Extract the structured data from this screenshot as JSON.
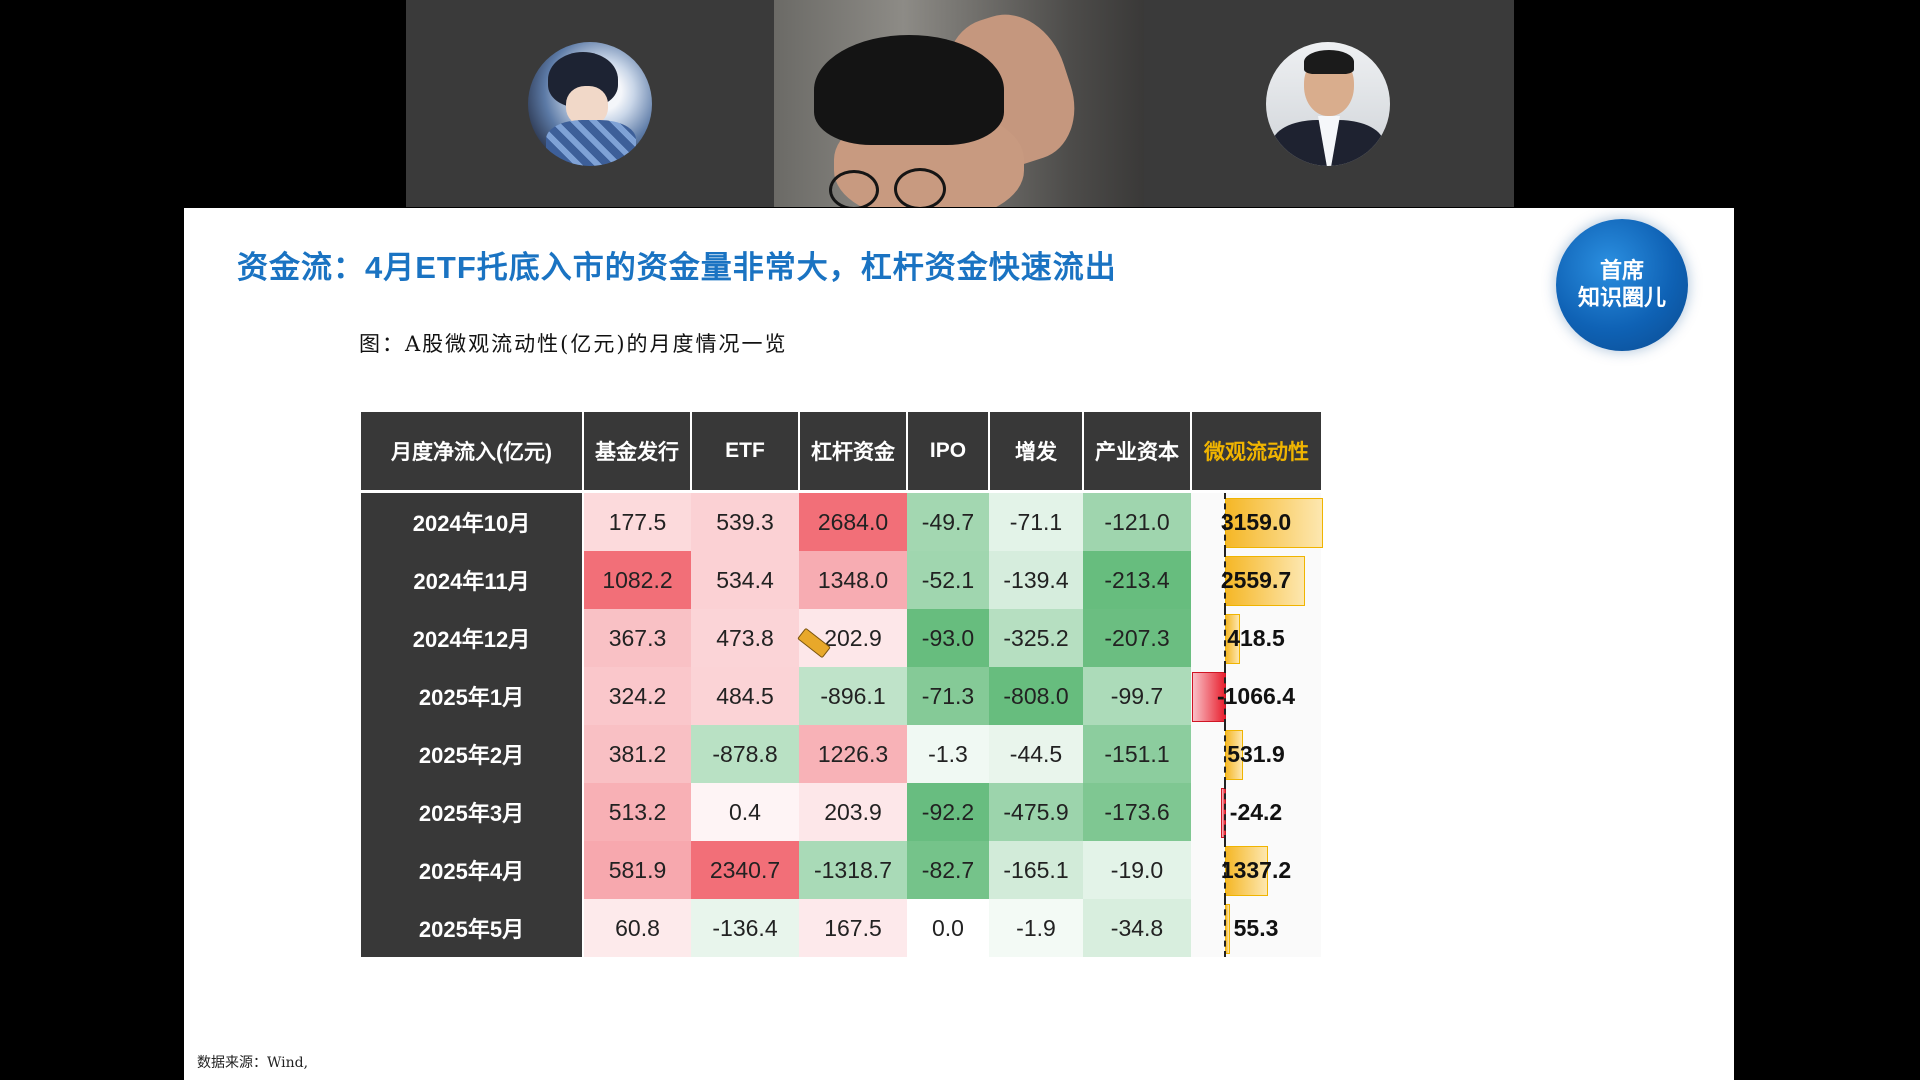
{
  "slide": {
    "title": "资金流：4月ETF托底入市的资金量非常大，杠杆资金快速流出",
    "logo_line1": "首席",
    "logo_line2": "知识圈儿",
    "caption": "图：A股微观流动性(亿元)的月度情况一览",
    "source": "数据来源：Wind,"
  },
  "table": {
    "headers": [
      "月度净流入(亿元)",
      "基金发行",
      "ETF",
      "杠杆资金",
      "IPO",
      "增发",
      "产业资本",
      "微观流动性"
    ],
    "rows": [
      {
        "month": "2024年10月",
        "cells": [
          "177.5",
          "539.3",
          "2684.0",
          "-49.7",
          "-71.1",
          "-121.0"
        ],
        "micro": "3159.0",
        "micro_value": 3159.0
      },
      {
        "month": "2024年11月",
        "cells": [
          "1082.2",
          "534.4",
          "1348.0",
          "-52.1",
          "-139.4",
          "-213.4"
        ],
        "micro": "2559.7",
        "micro_value": 2559.7
      },
      {
        "month": "2024年12月",
        "cells": [
          "367.3",
          "473.8",
          "202.9",
          "-93.0",
          "-325.2",
          "-207.3"
        ],
        "micro": "418.5",
        "micro_value": 418.5
      },
      {
        "month": "2025年1月",
        "cells": [
          "324.2",
          "484.5",
          "-896.1",
          "-71.3",
          "-808.0",
          "-99.7"
        ],
        "micro": "-1066.4",
        "micro_value": -1066.4
      },
      {
        "month": "2025年2月",
        "cells": [
          "381.2",
          "-878.8",
          "1226.3",
          "-1.3",
          "-44.5",
          "-151.1"
        ],
        "micro": "531.9",
        "micro_value": 531.9
      },
      {
        "month": "2025年3月",
        "cells": [
          "513.2",
          "0.4",
          "203.9",
          "-92.2",
          "-475.9",
          "-173.6"
        ],
        "micro": "-24.2",
        "micro_value": -24.2
      },
      {
        "month": "2025年4月",
        "cells": [
          "581.9",
          "2340.7",
          "-1318.7",
          "-82.7",
          "-165.1",
          "-19.0"
        ],
        "micro": "1337.2",
        "micro_value": 1337.2
      },
      {
        "month": "2025年5月",
        "cells": [
          "60.8",
          "-136.4",
          "167.5",
          "0.0",
          "-1.9",
          "-34.8"
        ],
        "micro": "55.3",
        "micro_value": 55.3
      }
    ]
  },
  "colors": {
    "title_blue": "#1a73c2",
    "header_dark": "#383838",
    "highlight_gold": "#f0b400",
    "positive_red": "#e8202f",
    "negative_green": "#2e9e4f"
  },
  "participants": {
    "left_avatar_icon": "anime-avatar-icon",
    "right_avatar_icon": "man-avatar-icon"
  }
}
